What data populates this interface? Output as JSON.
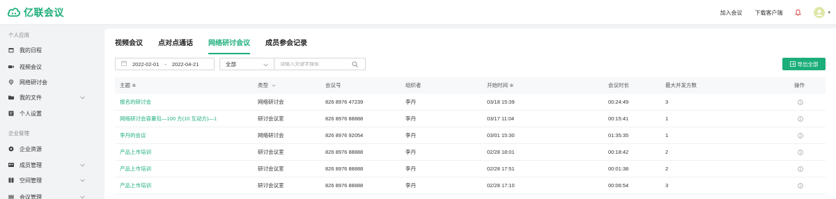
{
  "colors": {
    "accent": "#1cae7a"
  },
  "header": {
    "logo_text": "亿联会议",
    "join_meeting": "加入会议",
    "download_client": "下载客户端",
    "icons": [
      "cloud-logo-icon",
      "bell-icon",
      "avatar-icon",
      "caret-down-icon"
    ]
  },
  "sidebar": {
    "section_personal": "个人应用",
    "section_enterprise": "企业管理",
    "items": [
      {
        "label": "我的日程",
        "icon": "calendar-icon"
      },
      {
        "label": "视频会议",
        "icon": "video-camera-icon"
      },
      {
        "label": "网络研讨会",
        "icon": "webinar-icon"
      },
      {
        "label": "我的文件",
        "icon": "folder-icon"
      },
      {
        "label": "个人设置",
        "icon": "settings-card-icon"
      },
      {
        "label": "企业资源",
        "icon": "resource-icon"
      },
      {
        "label": "成员管理",
        "icon": "members-icon"
      },
      {
        "label": "空间管理",
        "icon": "space-icon"
      },
      {
        "label": "会议管理",
        "icon": "meeting-manage-icon"
      }
    ]
  },
  "tabs": [
    "视频会议",
    "点对点通话",
    "网络研讨会议",
    "成员参会记录"
  ],
  "active_tab": "网络研讨会议",
  "filters": {
    "date_start": "2022-02-01",
    "date_sep": "-",
    "date_end": "2022-04-21",
    "type_select": "全部",
    "search_placeholder": "请输入关键字搜索"
  },
  "export_label": "导出全部",
  "table": {
    "headers": {
      "subject": "主题 ≑",
      "type": "类型",
      "meeting_no": "会议号",
      "organizer": "组织者",
      "start_time": "开始时间 ≑",
      "duration": "会议时长",
      "max_concurrent": "最大并发方数",
      "operation": "操作"
    },
    "rows": [
      {
        "subject": "报名的研讨会",
        "type": "网络研讨会",
        "meeting_no": "826 8976 47239",
        "organizer": "李丹",
        "start_time": "03/18 15:39",
        "duration": "00:24:49",
        "max_concurrent": "3"
      },
      {
        "subject": "网络研讨会容量包—100 方(10 互动方)—1",
        "type": "研讨会议室",
        "meeting_no": "826 8976 88888",
        "organizer": "李丹",
        "start_time": "03/17 11:04",
        "duration": "00:15:41",
        "max_concurrent": "1"
      },
      {
        "subject": "李丹的会议",
        "type": "网络研讨会",
        "meeting_no": "826 8976 92054",
        "organizer": "李丹",
        "start_time": "03/01 15:30",
        "duration": "01:35:35",
        "max_concurrent": "1"
      },
      {
        "subject": "产品上市培训",
        "type": "研讨会议室",
        "meeting_no": "826 8976 88888",
        "organizer": "李丹",
        "start_time": "02/28 18:01",
        "duration": "00:18:42",
        "max_concurrent": "2"
      },
      {
        "subject": "产品上市培训",
        "type": "研讨会议室",
        "meeting_no": "826 8976 88888",
        "organizer": "李丹",
        "start_time": "02/28 17:51",
        "duration": "00:01:38",
        "max_concurrent": "2"
      },
      {
        "subject": "产品上市培训",
        "type": "研讨会议室",
        "meeting_no": "826 8976 88888",
        "organizer": "李丹",
        "start_time": "02/28 17:10",
        "duration": "00:06:54",
        "max_concurrent": "3"
      }
    ]
  }
}
